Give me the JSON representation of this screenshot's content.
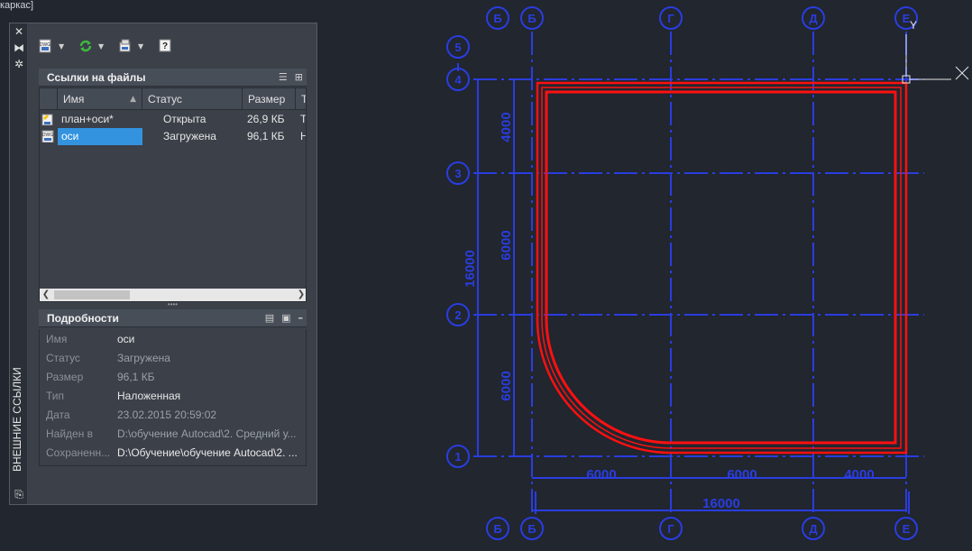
{
  "viewport": {
    "label": "каркас]"
  },
  "palette": {
    "side_title": "ВНЕШНИЕ ССЫЛКИ",
    "file_refs": {
      "title": "Ссылки на файлы",
      "columns": [
        "Имя",
        "Статус",
        "Размер",
        "Т"
      ],
      "rows": [
        {
          "name": "план+оси*",
          "status": "Открыта",
          "size": "26,9 КБ",
          "type": "Т",
          "icon": "dwg-current-icon"
        },
        {
          "name": "оси",
          "status": "Загружена",
          "size": "96,1 КБ",
          "type": "Н",
          "icon": "xref-dwg-icon",
          "selected": true
        }
      ]
    },
    "details": {
      "title": "Подробности",
      "rows": [
        {
          "label": "Имя",
          "value": "оси",
          "dim": false
        },
        {
          "label": "Статус",
          "value": "Загружена",
          "dim": true
        },
        {
          "label": "Размер",
          "value": "96,1 КБ",
          "dim": true
        },
        {
          "label": "Тип",
          "value": "Наложенная",
          "dim": false
        },
        {
          "label": "Дата",
          "value": "23.02.2015 20:59:02",
          "dim": true
        },
        {
          "label": "Найден в",
          "value": "D:\\обучение Autocad\\2. Средний у...",
          "dim": true
        },
        {
          "label": "Сохраненн...",
          "value": "D:\\Обучение\\обучение Autocad\\2. ...",
          "dim": false
        }
      ]
    }
  },
  "drawing": {
    "axis_labels_top": [
      "Б",
      "Г",
      "Д",
      "Е"
    ],
    "axis_labels_bottom": [
      "Б",
      "Г",
      "Д",
      "Е"
    ],
    "axis_label_left_top": "5",
    "axis_labels_left": [
      "4",
      "3",
      "2",
      "1"
    ],
    "dims_bottom": [
      "6000",
      "6000",
      "4000"
    ],
    "dim_total_bottom": "16000",
    "dims_left": [
      "4000",
      "6000",
      "6000"
    ],
    "dim_total_left": "16000",
    "ucs_y": "Y",
    "colors": {
      "axes": "#2a3de0",
      "walls": "#ff1010",
      "background": "#21262f"
    }
  }
}
